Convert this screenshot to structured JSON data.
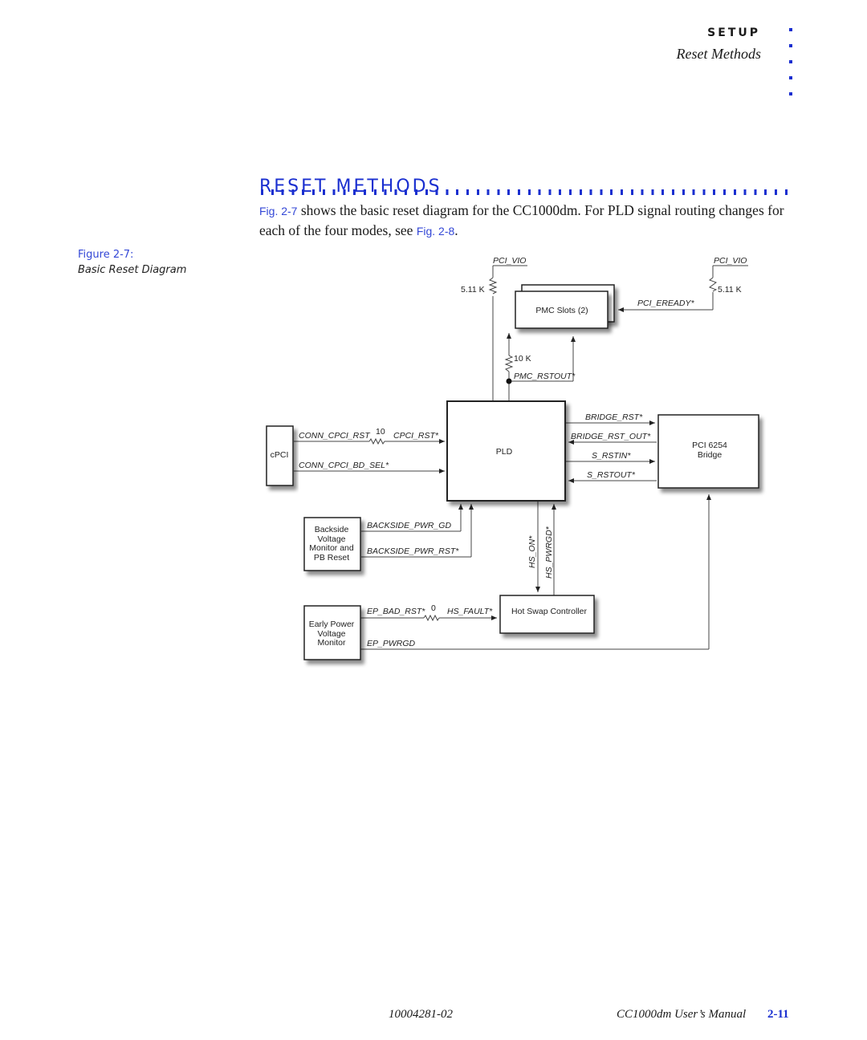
{
  "header": {
    "section": "SETUP",
    "subsection": "Reset Methods",
    "accent_color": "#1a2fd0"
  },
  "main": {
    "title": "RESET METHODS",
    "intro": {
      "link1": "Fig. 2-7",
      "text1": " shows the basic reset diagram for the CC1000dm. For PLD signal routing changes for each of the four modes, see ",
      "link2": "Fig. 2-8",
      "text2": "."
    }
  },
  "figure": {
    "number": "Figure 2-7:",
    "caption": "Basic Reset Diagram",
    "blocks": {
      "pmc": "PMC Slots (2)",
      "pld": "PLD",
      "cpci": "cPCI",
      "bridge_line1": "PCI 6254",
      "bridge_line2": "Bridge",
      "backside_line1": "Backside",
      "backside_line2": "Voltage",
      "backside_line3": "Monitor and",
      "backside_line4": "PB Reset",
      "hotswap": "Hot Swap Controller",
      "early_line1": "Early Power",
      "early_line2": "Voltage",
      "early_line3": "Monitor"
    },
    "signals": {
      "pci_vio_left": "PCI_VIO",
      "pci_vio_right": "PCI_VIO",
      "res_left": "5.11 K",
      "res_right": "5.11 K",
      "res_pmc": "10 K",
      "pci_eready": "PCI_EREADY*",
      "pmc_rstout": "PMC_RSTOUT*",
      "conn_cpci_rst": "CONN_CPCI_RST",
      "res_cpci": "10",
      "cpci_rst": "CPCI_RST*",
      "conn_cpci_bd_sel": "CONN_CPCI_BD_SEL*",
      "bridge_rst": "BRIDGE_RST*",
      "bridge_rst_out": "BRIDGE_RST_OUT*",
      "s_rstin": "S_RSTIN*",
      "s_rstout": "S_RSTOUT*",
      "backside_pwr_gd": "BACKSIDE_PWR_GD",
      "backside_pwr_rst": "BACKSIDE_PWR_RST*",
      "hs_on": "HS_ON*",
      "hs_pwrgd": "HS_PWRGD*",
      "ep_bad_rst": "EP_BAD_RST*",
      "res_ep": "0",
      "hs_fault": "HS_FAULT*",
      "ep_pwrgd": "EP_PWRGD"
    }
  },
  "footer": {
    "doc_id": "10004281-02",
    "manual": "CC1000dm User’s Manual",
    "page": "2-11"
  }
}
